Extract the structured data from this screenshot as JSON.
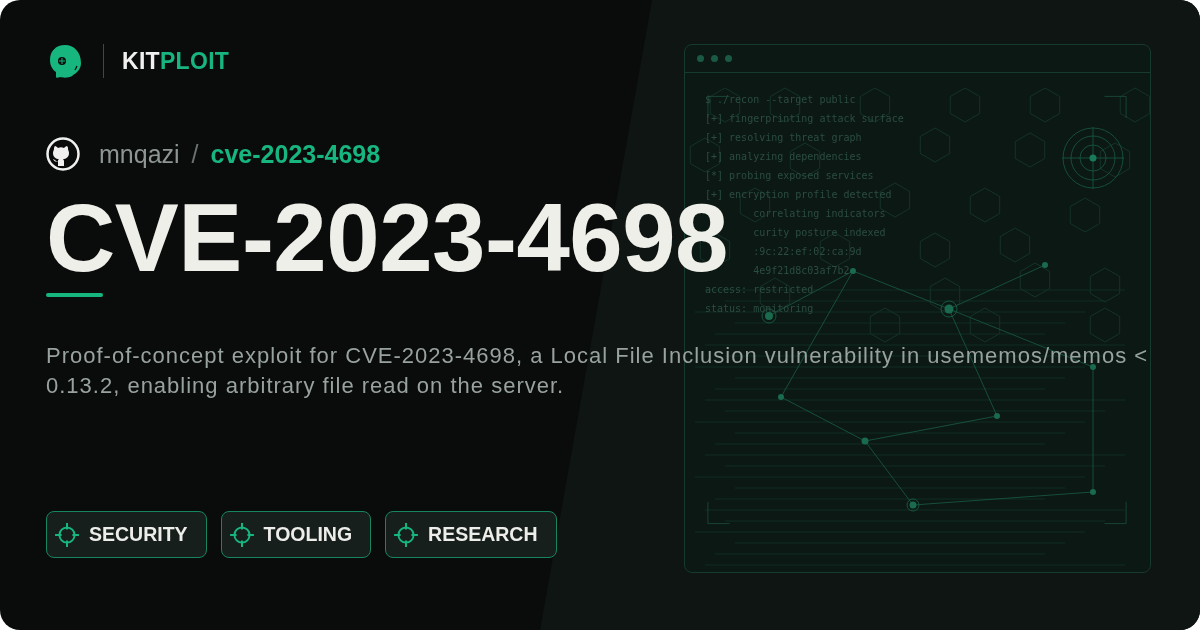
{
  "brand": {
    "first": "KIT",
    "second": "PLOIT"
  },
  "repo": {
    "owner": "mnqazi",
    "separator": "/",
    "name": "cve-2023-4698"
  },
  "title": "CVE-2023-4698",
  "description": "Proof-of-concept exploit for CVE-2023-4698, a Local File Inclusion vulnerability in usememos/memos < 0.13.2, enabling arbitrary file read on the server.",
  "tags": [
    "SECURITY",
    "TOOLING",
    "RESEARCH"
  ],
  "terminal": {
    "lines": [
      {
        "kind": "full",
        "text": "$ ./recon --target public"
      },
      {
        "kind": "full",
        "text": "[+] fingerprinting attack surface"
      },
      {
        "kind": "full",
        "text": "[+] resolving threat graph"
      },
      {
        "kind": "full",
        "text": "[+] analyzing dependencies"
      },
      {
        "kind": "full",
        "text": "[*] probing exposed services"
      },
      {
        "kind": "full",
        "text": "[+] encryption profile detected"
      },
      {
        "kind": "partial",
        "text": "correlating indicators"
      },
      {
        "kind": "partial",
        "text": "curity posture indexed"
      },
      {
        "kind": "partial",
        "text": ":9c:22:ef:02:ca:9d"
      },
      {
        "kind": "partial",
        "text": "4e9f21d8c03af7b2"
      },
      {
        "kind": "full",
        "text": "access: restricted"
      },
      {
        "kind": "full",
        "text": "status: monitoring"
      }
    ]
  }
}
